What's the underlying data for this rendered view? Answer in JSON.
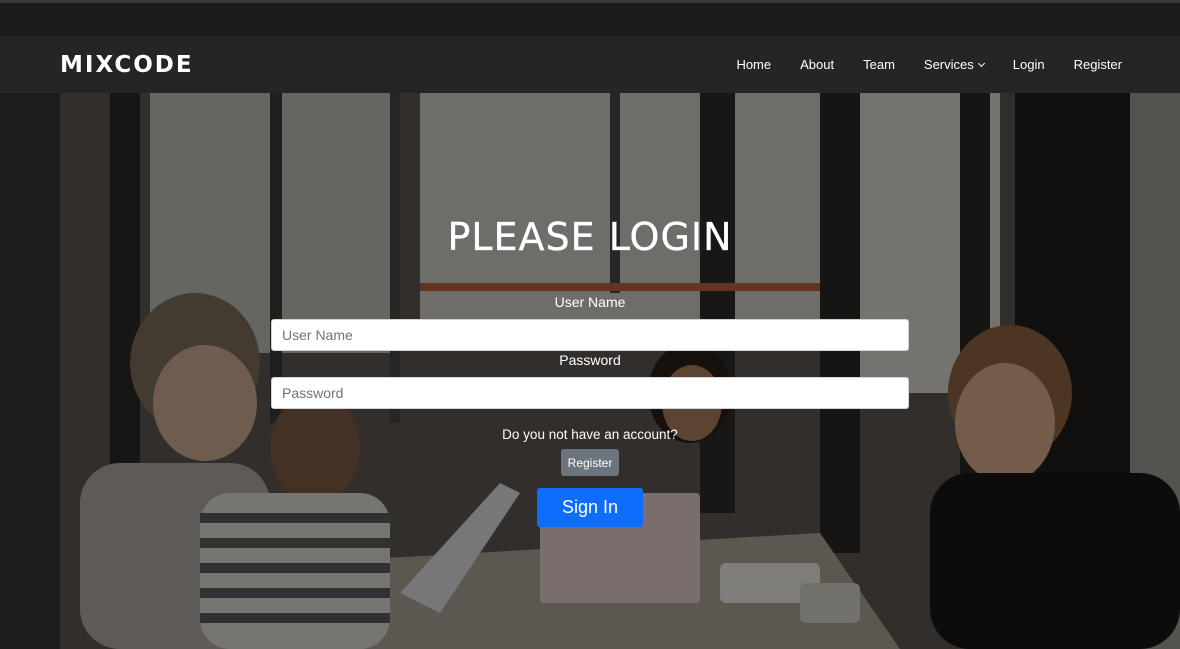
{
  "brand": {
    "name": "MIXCODE"
  },
  "nav": {
    "items": [
      {
        "label": "Home"
      },
      {
        "label": "About"
      },
      {
        "label": "Team"
      },
      {
        "label": "Services",
        "has_dropdown": true
      },
      {
        "label": "Login"
      },
      {
        "label": "Register"
      }
    ]
  },
  "login": {
    "title": "PLEASE LOGIN",
    "username_label": "User Name",
    "username_placeholder": "User Name",
    "username_value": "",
    "password_label": "Password",
    "password_placeholder": "Password",
    "password_value": "",
    "account_question": "Do you not have an account?",
    "register_label": "Register",
    "signin_label": "Sign In"
  },
  "colors": {
    "navbar_bg": "#252525",
    "top_strip_bg": "#1b1b1b",
    "signin_button": "#0d6efd",
    "register_button": "#6c757d"
  },
  "icons": {
    "services_dropdown": "chevron-down-icon"
  }
}
